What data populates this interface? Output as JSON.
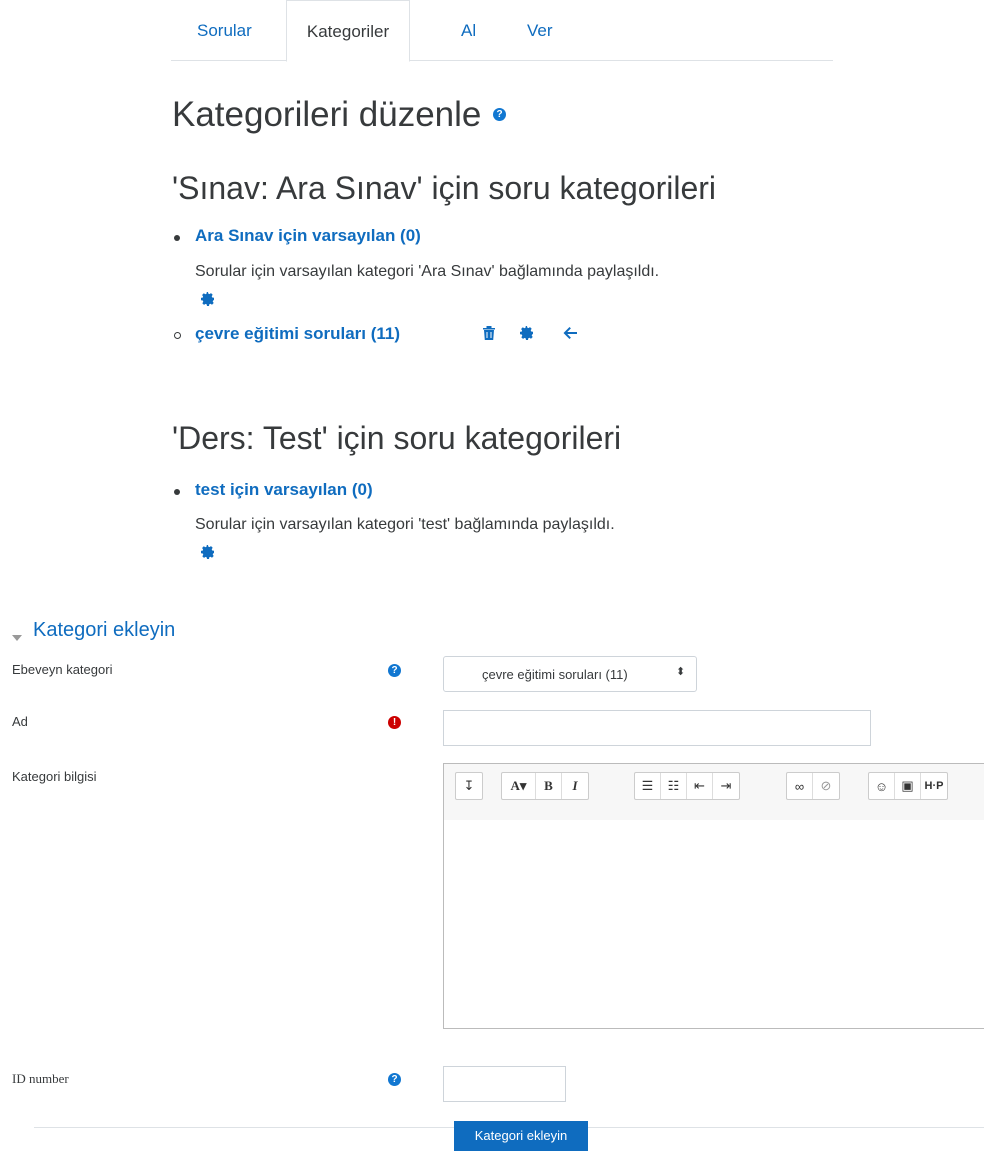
{
  "tabs": [
    {
      "label": "Sorular"
    },
    {
      "label": "Kategoriler"
    },
    {
      "label": "Al"
    },
    {
      "label": "Ver"
    }
  ],
  "page_title": "Kategorileri düzenle",
  "sections": [
    {
      "heading": "'Sınav: Ara Sınav' için soru kategorileri",
      "items": [
        {
          "name": "Ara Sınav için varsayılan (0)",
          "desc": "Sorular için varsayılan kategori 'Ara Sınav' bağlamında paylaşıldı."
        }
      ],
      "subitems": [
        {
          "name": "çevre eğitimi soruları (11)"
        }
      ]
    },
    {
      "heading": "'Ders: Test' için soru kategorileri",
      "items": [
        {
          "name": "test için varsayılan (0)",
          "desc": "Sorular için varsayılan kategori 'test' bağlamında paylaşıldı."
        }
      ]
    }
  ],
  "form": {
    "section_title": "Kategori ekleyin",
    "parent_label": "Ebeveyn kategori",
    "parent_value": "çevre eğitimi soruları (11)",
    "name_label": "Ad",
    "info_label": "Kategori bilgisi",
    "idnumber_label": "ID number",
    "submit_label": "Kategori ekleyin"
  },
  "icons": {
    "help": "help-icon",
    "required": "required-icon",
    "settings": "gear-icon",
    "delete": "trash-icon",
    "move": "arrow-left-icon"
  },
  "colors": {
    "accent": "#0f6cbf",
    "required": "#cc0000"
  }
}
